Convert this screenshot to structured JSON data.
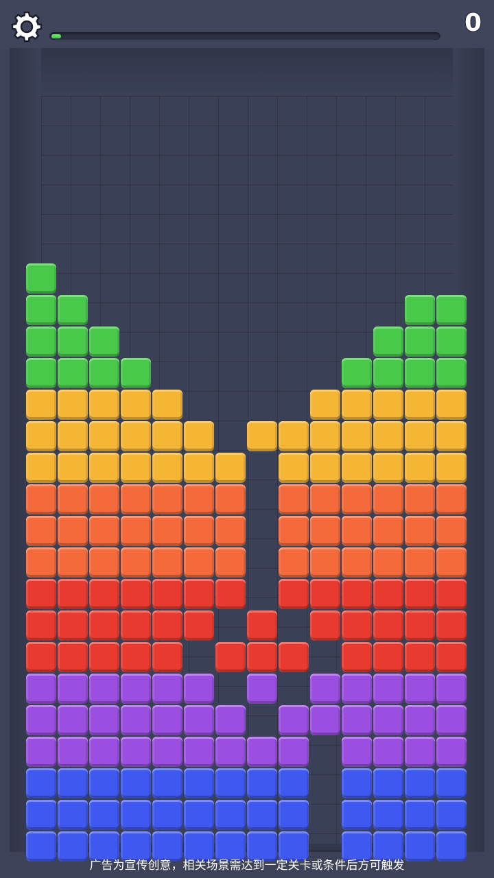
{
  "hud": {
    "score": "0",
    "progress": 0.02,
    "settings_icon": "gear-icon"
  },
  "caption": "广告为宣传创意，相关场景需达到一定关卡或条件后方可触发",
  "colors": {
    "green": "#48c94a",
    "yellow": "#f5b636",
    "orange": "#f46a3a",
    "red": "#e83a2f",
    "purple": "#9b4fe0",
    "blue": "#3f58f0"
  },
  "board": {
    "columns": 14,
    "rows": [
      "G.............",
      "GG..........GG",
      "GGG........GGG",
      "GGGG......GGGG",
      "YYYYY....YYYYY",
      "YYYYYY.YYYYYYY",
      "YYYYYYY.YYYYYY",
      "OOOOOOO.OOOOOO",
      "OOOOOOO.OOOOOO",
      "OOOOOOO.OOOOOO",
      "RRRRRRR.RRRRRR",
      "RRRRRR.R.RRRRR",
      "RRRRR.RRR.RRRR",
      "PPPPPP.P.PPPPP",
      "PPPPPPP.PPPPPP",
      "PPPPPPPPP.PPPP",
      "BBBBBBBBB.BBBB",
      "BBBBBBBBB.BBBB",
      "BBBBBBBBB.BBBB"
    ]
  }
}
